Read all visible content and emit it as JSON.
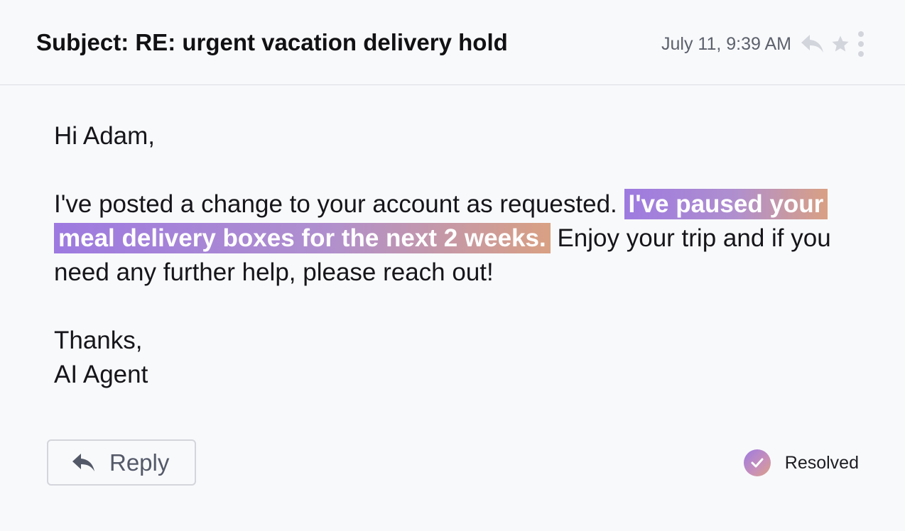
{
  "email": {
    "subject": "Subject: RE: urgent vacation delivery hold",
    "timestamp": "July 11, 9:39 AM",
    "icons": {
      "reply": "reply-arrow-icon",
      "star": "star-icon",
      "more": "more-vertical-icon"
    },
    "body": {
      "greeting": "Hi Adam,",
      "paragraph_intro": "I've posted a change to your account as requested.",
      "paragraph_highlight": "I've paused your meal delivery boxes for the next 2 weeks.",
      "paragraph_outro": "Enjoy your trip and if you need any further help, please reach out!",
      "signoff": "Thanks,",
      "signature": "AI Agent"
    }
  },
  "footer": {
    "reply_label": "Reply",
    "status_label": "Resolved"
  },
  "colors": {
    "highlight_start": "#9d7ae0",
    "highlight_end": "#d9a083",
    "muted_icon": "#d3d5dc",
    "reply_text": "#545969"
  }
}
